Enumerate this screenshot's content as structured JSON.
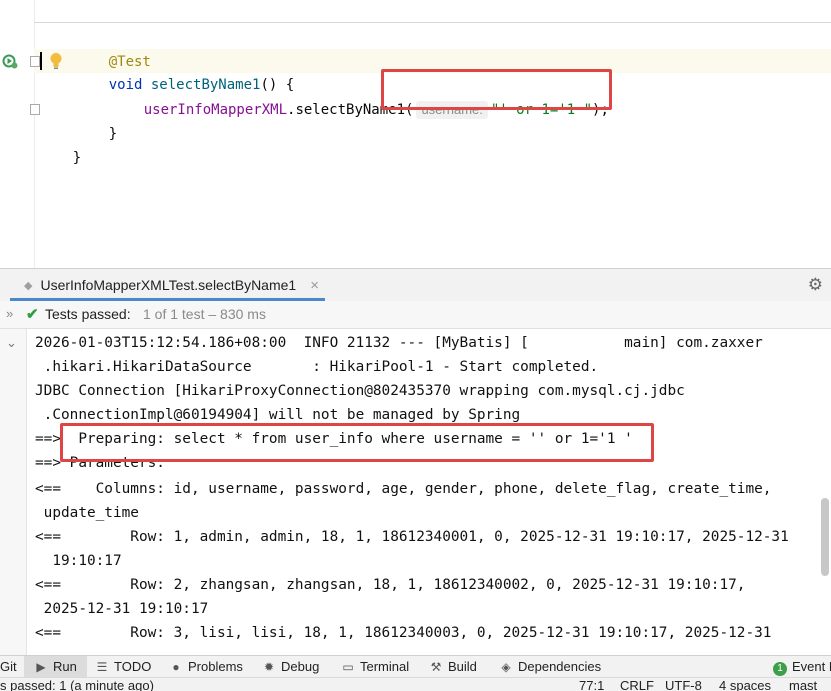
{
  "editor": {
    "annotation": "@Test",
    "method_keyword": "void",
    "method_name": "selectByName1",
    "method_suffix": "() {",
    "call_target": "userInfoMapperXML",
    "call_method": ".selectByName1(",
    "param_hint": "username:",
    "arg_literal": "\"' or 1='1 \"",
    "call_end": ");",
    "close_inner": "}",
    "close_outer": "}"
  },
  "run": {
    "tab_label": "UserInfoMapperXMLTest.selectByName1",
    "close_glyph": "×",
    "tests_passed": "Tests passed:",
    "tests_detail": "1 of 1 test – 830 ms"
  },
  "console": {
    "lines": [
      "2026-01-03T15:12:54.186+08:00  INFO 21132 --- [MyBatis] [           main] com.zaxxer",
      " .hikari.HikariDataSource       : HikariPool-1 - Start completed.",
      "JDBC Connection [HikariProxyConnection@802435370 wrapping com.mysql.cj.jdbc",
      " .ConnectionImpl@60194904] will not be managed by Spring",
      "==>  Preparing: select * from user_info where username = '' or 1='1 '",
      "==> Parameters:",
      "<==    Columns: id, username, password, age, gender, phone, delete_flag, create_time,",
      " update_time",
      "<==        Row: 1, admin, admin, 18, 1, 18612340001, 0, 2025-12-31 19:10:17, 2025-12-31",
      "  19:10:17",
      "<==        Row: 2, zhangsan, zhangsan, 18, 1, 18612340002, 0, 2025-12-31 19:10:17,",
      " 2025-12-31 19:10:17",
      "<==        Row: 3, lisi, lisi, 18, 1, 18612340003, 0, 2025-12-31 19:10:17, 2025-12-31"
    ]
  },
  "toolbar": {
    "git": "Git",
    "run": "Run",
    "todo": "TODO",
    "problems": "Problems",
    "debug": "Debug",
    "terminal": "Terminal",
    "build": "Build",
    "dependencies": "Dependencies",
    "event_log": "Event L"
  },
  "statusbar": {
    "message": "s passed: 1 (a minute ago)",
    "position": "77:1",
    "line_sep": "CRLF",
    "encoding": "UTF-8",
    "indent": "4 spaces",
    "branch": "mast"
  },
  "colors": {
    "highlight_box": "#e04545",
    "pass_green": "#2f9e44",
    "keyword": "#0033b3",
    "string": "#067d17"
  }
}
